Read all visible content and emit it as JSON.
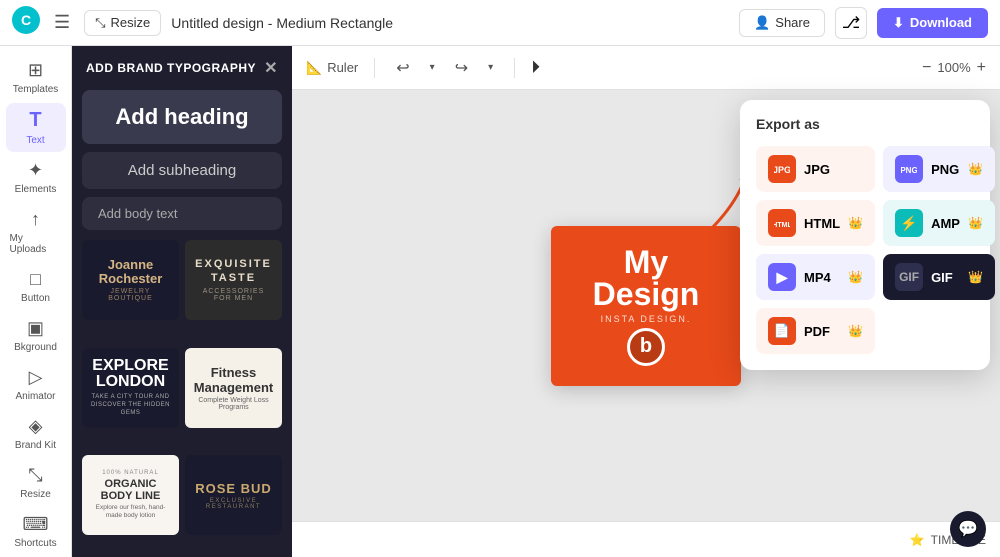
{
  "app": {
    "title": "Untitled design - Medium Rectangle",
    "logo_alt": "Canva Logo"
  },
  "topbar": {
    "menu_label": "☰",
    "resize_label": "Resize",
    "share_label": "Share",
    "download_label": "Download"
  },
  "sidebar": {
    "items": [
      {
        "id": "templates",
        "label": "Templates",
        "icon": "⊞"
      },
      {
        "id": "text",
        "label": "Text",
        "icon": "T"
      },
      {
        "id": "elements",
        "label": "Elements",
        "icon": "✦"
      },
      {
        "id": "uploads",
        "label": "My Uploads",
        "icon": "↑"
      },
      {
        "id": "button",
        "label": "Button",
        "icon": "□"
      },
      {
        "id": "background",
        "label": "Bkground",
        "icon": "▣"
      },
      {
        "id": "animator",
        "label": "Animator",
        "icon": "▷"
      },
      {
        "id": "brandkit",
        "label": "Brand Kit",
        "icon": "◈"
      },
      {
        "id": "resize",
        "label": "Resize",
        "icon": "⤡"
      },
      {
        "id": "shortcuts",
        "label": "Shortcuts",
        "icon": "⌨"
      }
    ]
  },
  "left_panel": {
    "header": "ADD BRAND TYPOGRAPHY",
    "text_options": {
      "heading": "Add heading",
      "subheading": "Add subheading",
      "body": "Add body text"
    },
    "templates": [
      {
        "id": "joanne",
        "name": "Joanne Rochester",
        "sub": "JEWELRY BOUTIQUE",
        "style": "gold-dark"
      },
      {
        "id": "exquisite",
        "name": "EXQUISITE TASTE",
        "sub": "ACCESSORIES FOR MEN",
        "style": "cream-dark"
      },
      {
        "id": "explore",
        "name": "EXPLORE LONDON",
        "desc": "TAKE A CITY TOUR AND DISCOVER THE HIDDEN GEMS",
        "style": "white-dark"
      },
      {
        "id": "fitness",
        "name": "Fitness Management",
        "sub": "Complete Weight Loss Programs",
        "style": "dark-light"
      },
      {
        "id": "organic",
        "name": "ORGANIC BODY LINE",
        "tag": "100% NATURAL",
        "desc": "Explore our fresh, hand-made body lotion",
        "style": "dark-light"
      },
      {
        "id": "rosebud",
        "name": "ROSE BUD",
        "sub": "EXCLUSIVE RESTAURANT",
        "style": "gold-dark"
      }
    ]
  },
  "toolbar": {
    "ruler_label": "Ruler",
    "zoom_level": "100%"
  },
  "design": {
    "title": "My Design",
    "subtitle": "Insta Design.",
    "logo_char": "b"
  },
  "export_panel": {
    "title": "Export as",
    "formats": [
      {
        "id": "jpg",
        "label": "JPG",
        "icon": "🖼",
        "premium": false,
        "style": "jpg"
      },
      {
        "id": "png",
        "label": "PNG",
        "icon": "🖼",
        "premium": true,
        "style": "png"
      },
      {
        "id": "html",
        "label": "HTML",
        "icon": "🌐",
        "premium": true,
        "style": "html"
      },
      {
        "id": "amp",
        "label": "AMP",
        "icon": "⚡",
        "premium": true,
        "style": "amp"
      },
      {
        "id": "mp4",
        "label": "MP4",
        "icon": "▶",
        "premium": true,
        "style": "mp4"
      },
      {
        "id": "gif",
        "label": "GIF",
        "icon": "🎞",
        "premium": true,
        "style": "gif"
      },
      {
        "id": "pdf",
        "label": "PDF",
        "icon": "📄",
        "premium": true,
        "style": "pdf"
      }
    ],
    "crown_icon": "👑"
  },
  "bottom_bar": {
    "timeline_label": "TIMELINE",
    "star_icon": "⭐"
  }
}
